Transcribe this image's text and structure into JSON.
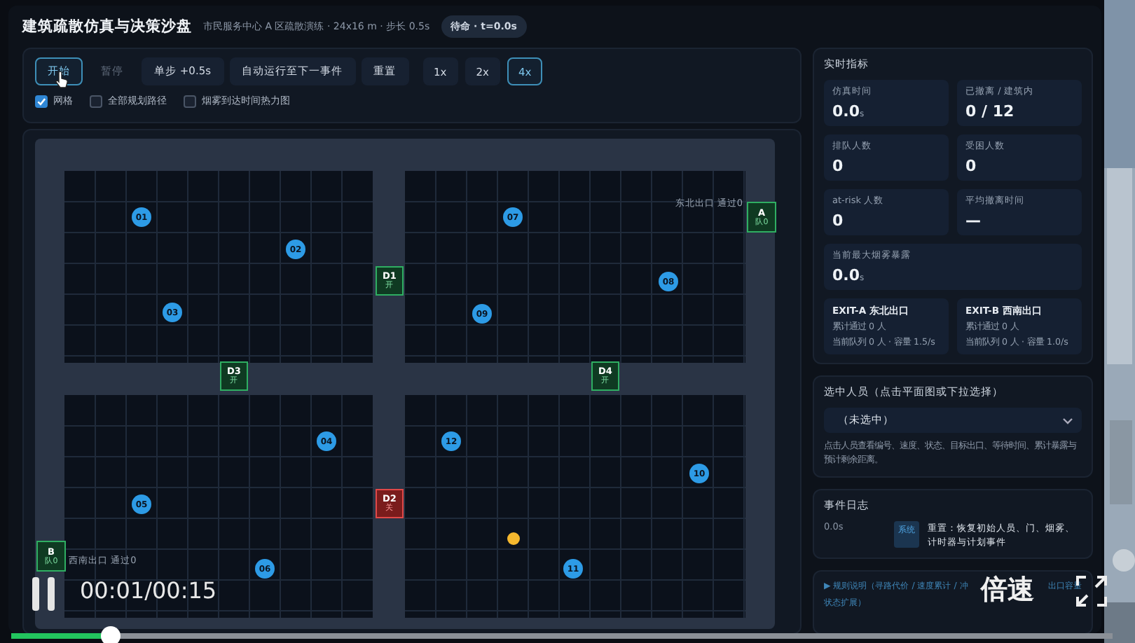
{
  "header": {
    "title": "建筑疏散仿真与决策沙盘",
    "subtitle": "市民服务中心 A 区疏散演练 · 24x16 m · 步长 0.5s",
    "status": "待命 · t=0.0s"
  },
  "toolbar": {
    "buttons": [
      {
        "label": "开始",
        "selected": true,
        "disabled": false
      },
      {
        "label": "暂停",
        "selected": false,
        "disabled": true
      },
      {
        "label": "单步 +0.5s",
        "selected": false,
        "disabled": false
      },
      {
        "label": "自动运行至下一事件",
        "selected": false,
        "disabled": false
      },
      {
        "label": "重置",
        "selected": false,
        "disabled": false
      }
    ],
    "speeds": [
      {
        "label": "1x",
        "selected": false
      },
      {
        "label": "2x",
        "selected": false
      },
      {
        "label": "4x",
        "selected": true
      }
    ],
    "options": [
      {
        "label": "网格",
        "checked": true
      },
      {
        "label": "全部规划路径",
        "checked": false
      },
      {
        "label": "烟雾到达时间热力图",
        "checked": false
      }
    ]
  },
  "map": {
    "doors": [
      {
        "kind": "door",
        "label": "D1",
        "state": "开",
        "open": true
      },
      {
        "kind": "door",
        "label": "D3",
        "state": "开",
        "open": true
      },
      {
        "kind": "door",
        "label": "D4",
        "state": "开",
        "open": true
      },
      {
        "kind": "door",
        "label": "D2",
        "state": "关",
        "open": false
      },
      {
        "kind": "exit",
        "label": "A",
        "state": "队0",
        "open": true,
        "caption": "东北出口 通过0"
      },
      {
        "kind": "exit",
        "label": "B",
        "state": "队0",
        "open": true,
        "caption": "西南出口 通过0"
      }
    ],
    "people": [
      {
        "label": "01"
      },
      {
        "label": "02"
      },
      {
        "label": "03"
      },
      {
        "label": "07"
      },
      {
        "label": "08"
      },
      {
        "label": "09"
      },
      {
        "label": "04"
      },
      {
        "label": "05"
      },
      {
        "label": "06"
      },
      {
        "label": "12"
      },
      {
        "label": "10"
      },
      {
        "label": "11"
      }
    ],
    "hazards": [
      {
        "kind": "fire",
        "color": "#f5b82e"
      }
    ]
  },
  "metrics": {
    "title": "实时指标",
    "cards": [
      {
        "label": "仿真时间",
        "value": "0.0",
        "unit": "s",
        "wide": false
      },
      {
        "label": "已撤离 / 建筑内",
        "value": "0 / 12",
        "wide": false
      },
      {
        "label": "排队人数",
        "value": "0",
        "wide": false
      },
      {
        "label": "受困人数",
        "value": "0",
        "wide": false
      },
      {
        "label": "at-risk 人数",
        "value": "0",
        "wide": false
      },
      {
        "label": "平均撤离时间",
        "value": "—",
        "wide": false
      },
      {
        "label": "当前最大烟雾暴露",
        "value": "0.0",
        "unit": "s",
        "wide": true
      }
    ],
    "exits": [
      {
        "name": "EXIT-A 东北出口",
        "passed": "累计通过 0 人",
        "queue": "当前队列 0 人 · 容量 1.5/s"
      },
      {
        "name": "EXIT-B 西南出口",
        "passed": "累计通过 0 人",
        "queue": "当前队列 0 人 · 容量 1.0/s"
      }
    ]
  },
  "selection": {
    "title": "选中人员（点击平面图或下拉选择）",
    "value": "（未选中）",
    "hint": "点击人员查看编号、速度、状态、目标出口、等待时间、累计暴露与预计剩余距离。"
  },
  "log": {
    "title": "事件日志",
    "entries": [
      {
        "time": "0.0s",
        "tag": "系统",
        "text": "重置：恢复初始人员、门、烟雾、计时器与计划事件"
      }
    ]
  },
  "rules": {
    "parts": [
      "▶ 规则说明（寻路代价 / 速度累计 / 冲",
      "出口容量",
      "状态扩展）"
    ]
  },
  "player": {
    "playing": true,
    "time": "00:01/00:15",
    "speed": "倍速",
    "progress": {
      "level": 0.09
    }
  }
}
